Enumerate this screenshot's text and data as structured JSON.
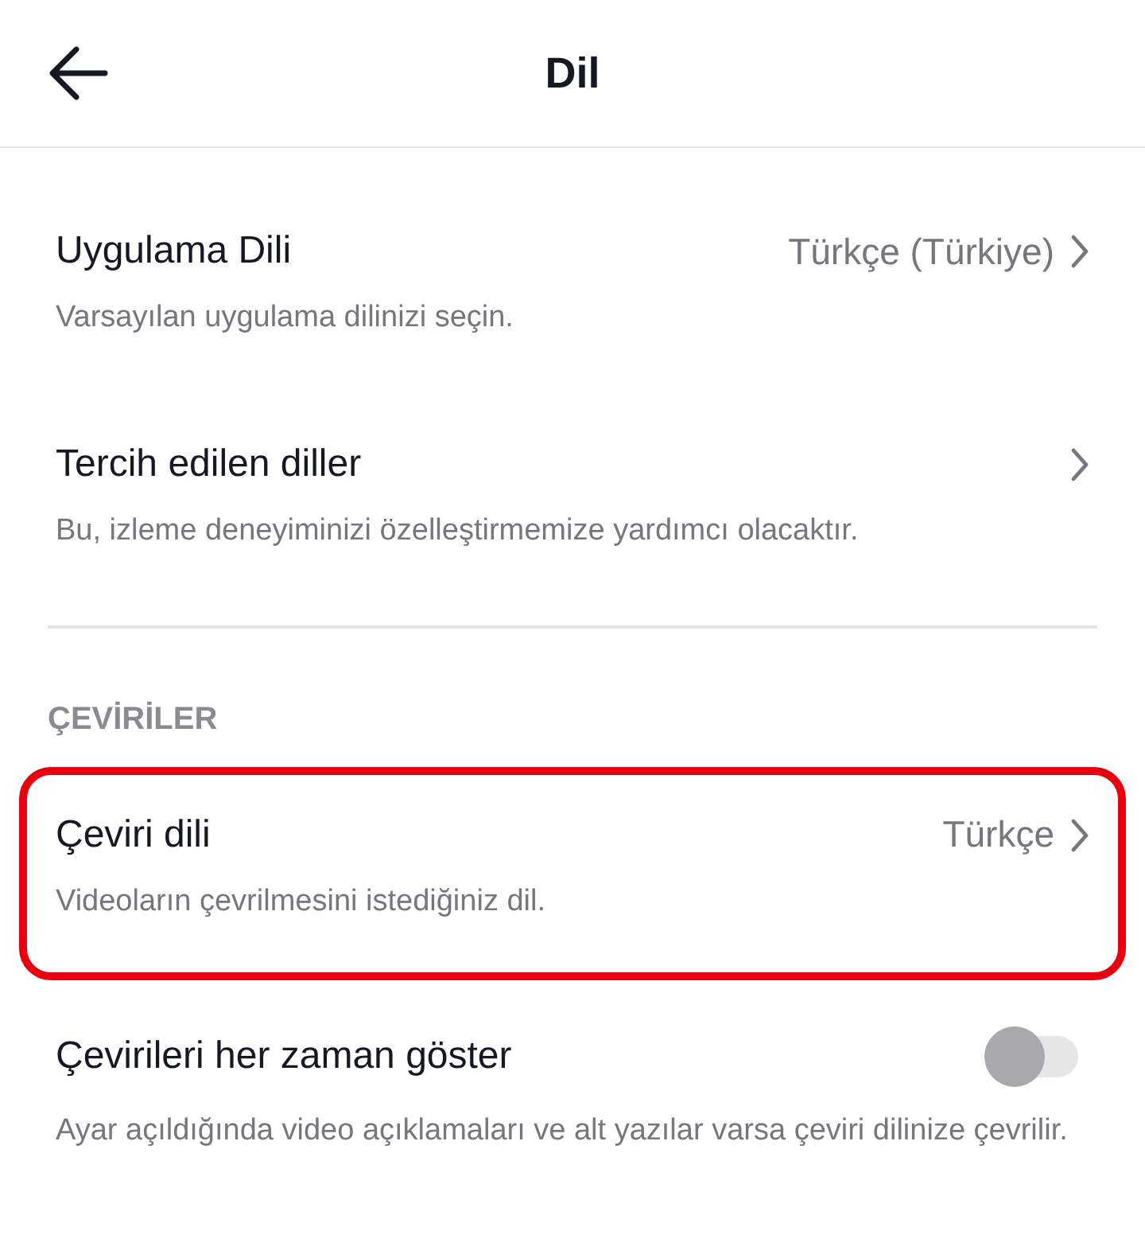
{
  "header": {
    "title": "Dil"
  },
  "sections": [
    {
      "items": [
        {
          "kind": "link",
          "title": "Uygulama Dili",
          "value": "Türkçe (Türkiye)",
          "description": "Varsayılan uygulama dilinizi seçin.",
          "highlighted": false
        },
        {
          "kind": "link",
          "title": "Tercih edilen diller",
          "description": "Bu, izleme deneyiminizi özelleştirmemize yardımcı olacaktır.",
          "highlighted": false
        }
      ]
    },
    {
      "heading": "ÇEVİRİLER",
      "items": [
        {
          "kind": "link",
          "title": "Çeviri dili",
          "value": "Türkçe",
          "description": "Videoların çevrilmesini istediğiniz dil.",
          "highlighted": true
        },
        {
          "kind": "toggle",
          "title": "Çevirileri her zaman göster",
          "on": false,
          "description": "Ayar açıldığında video açıklamaları ve alt yazılar varsa çeviri dilinize çevrilir.",
          "highlighted": false
        }
      ]
    }
  ]
}
